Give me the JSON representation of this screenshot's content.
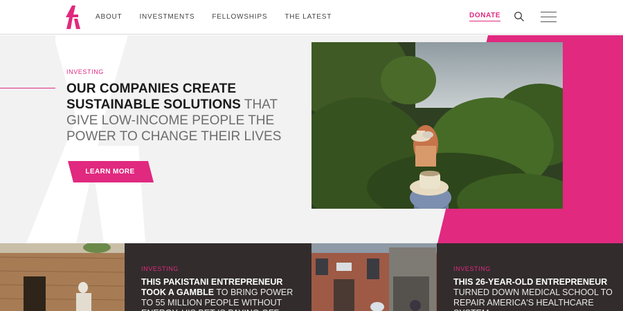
{
  "header": {
    "logo_icon": "a-logo-icon",
    "nav": [
      "ABOUT",
      "INVESTMENTS",
      "FELLOWSHIPS",
      "THE LATEST"
    ],
    "donate": "DONATE",
    "search_icon": "search-icon",
    "menu_icon": "hamburger-menu-icon"
  },
  "hero": {
    "eyebrow": "INVESTING",
    "title_strong": "OUR COMPANIES CREATE SUSTAINABLE SOLUTIONS",
    "title_light": "THAT GIVE LOW-INCOME PEOPLE THE POWER TO CHANGE THEIR LIVES",
    "cta": "LEARN MORE",
    "photo": "people-in-hats-walking-through-coffee-farm"
  },
  "cards": [
    {
      "photo": "man-in-front-of-mud-brick-house",
      "eyebrow": "INVESTING",
      "title_strong": "THIS PAKISTANI ENTREPRENEUR TOOK A GAMBLE",
      "title_light": "TO BRING POWER TO 55 MILLION PEOPLE WITHOUT ENERGY. HIS BET IS PAYING OFF."
    },
    {
      "photo": "brick-apartment-building-street",
      "eyebrow": "INVESTING",
      "title_strong": "THIS 26-YEAR-OLD ENTREPRENEUR",
      "title_light": "TURNED DOWN MEDICAL SCHOOL TO REPAIR AMERICA'S HEALTHCARE SYSTEM"
    }
  ],
  "colors": {
    "brand_pink": "#e0297f",
    "dark_card": "#322c2c",
    "hero_bg": "#f2f2f2"
  }
}
